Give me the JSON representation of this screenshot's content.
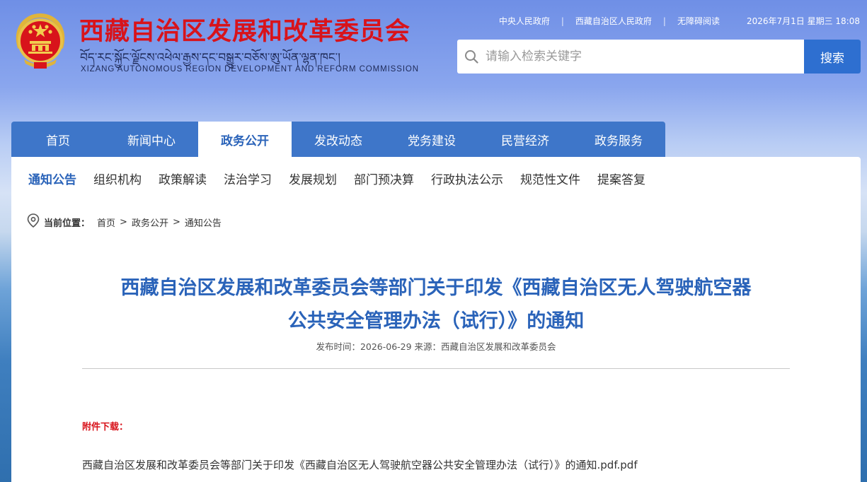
{
  "header": {
    "title": "西藏自治区发展和改革委员会",
    "tibetan": "བོད་རང་སྐྱོང་ལྗོངས་འཕེལ་རྒྱས་དང་བསྒྱུར་བཅོས་ཨུ་ཡོན་ལྷན་ཁང་།",
    "english": "XIZANG AUTONOMOUS REGION DEVELOPMENT AND REFORM COMMISSION",
    "emblem_icon": "national-emblem-icon"
  },
  "toplinks": {
    "items": [
      "中央人民政府",
      "西藏自治区人民政府",
      "无障碍阅读"
    ],
    "separator": "|",
    "date": "2026年7月1日 星期三 18:08"
  },
  "search": {
    "placeholder": "请输入检索关键字",
    "value": "",
    "button": "搜索",
    "icon": "search-icon"
  },
  "mainnav": {
    "items": [
      "首页",
      "新闻中心",
      "政务公开",
      "发改动态",
      "党务建设",
      "民营经济",
      "政务服务"
    ],
    "active": "政务公开"
  },
  "subnav": {
    "items": [
      "通知公告",
      "组织机构",
      "政策解读",
      "法治学习",
      "发展规划",
      "部门预决算",
      "行政执法公示",
      "规范性文件",
      "提案答复"
    ],
    "active": "通知公告"
  },
  "breadcrumb": {
    "label": "当前位置：",
    "items": [
      "首页",
      "政务公开",
      "通知公告"
    ],
    "separator": ">",
    "icon": "location-pin-icon"
  },
  "article": {
    "title_line1": "西藏自治区发展和改革委员会等部门关于印发《西藏自治区无人驾驶航空器",
    "title_line2": "公共安全管理办法（试行）》的通知",
    "meta": "发布时间：2026-06-29 来源：西藏自治区发展和改革委员会",
    "attachment_label": "附件下载：",
    "attachment_file": "西藏自治区发展和改革委员会等部门关于印发《西藏自治区无人驾驶航空器公共安全管理办法（试行）》的通知.pdf.pdf"
  },
  "colors": {
    "brand_red": "#d8131b",
    "brand_blue": "#2a63b9",
    "nav_blue": "#3e76c9",
    "button_blue": "#2e6fd0"
  }
}
